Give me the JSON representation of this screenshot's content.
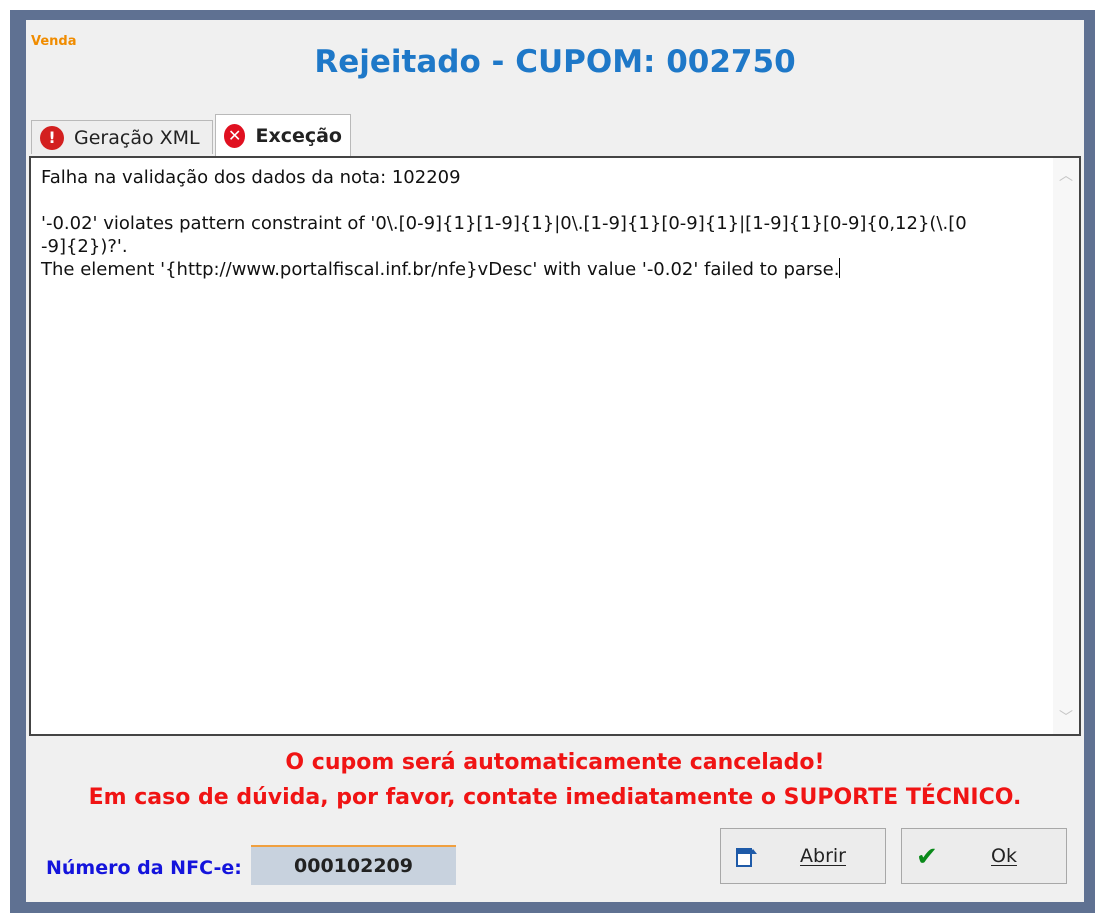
{
  "app_label": "Venda",
  "title": "Rejeitado - CUPOM: 002750",
  "tabs": [
    {
      "label": "Geração XML",
      "icon": "warning-icon"
    },
    {
      "label": "Exceção",
      "icon": "error-icon"
    }
  ],
  "message": {
    "line1": "Falha na validação dos dados da nota: 102209",
    "line2": "'-0.02' violates pattern constraint of '0\\.[0-9]{1}[1-9]{1}|0\\.[1-9]{1}[0-9]{1}|[1-9]{1}[0-9]{0,12}(\\.[0",
    "line3": "-9]{2})?'.",
    "line4": "The element '{http://www.portalfiscal.inf.br/nfe}vDesc' with value '-0.02' failed to parse."
  },
  "warning": {
    "line1": "O cupom será automaticamente cancelado!",
    "line2": "Em caso de dúvida, por favor, contate imediatamente o SUPORTE TÉCNICO."
  },
  "nfe": {
    "label": "Número da NFC-e:",
    "value": "000102209"
  },
  "buttons": {
    "abrir": "Abrir",
    "ok": "Ok"
  },
  "colors": {
    "title": "#1e78c8",
    "app_label": "#f08c00",
    "warning": "#f01414",
    "nfe_label": "#1414dc",
    "frame": "#5f7192"
  }
}
